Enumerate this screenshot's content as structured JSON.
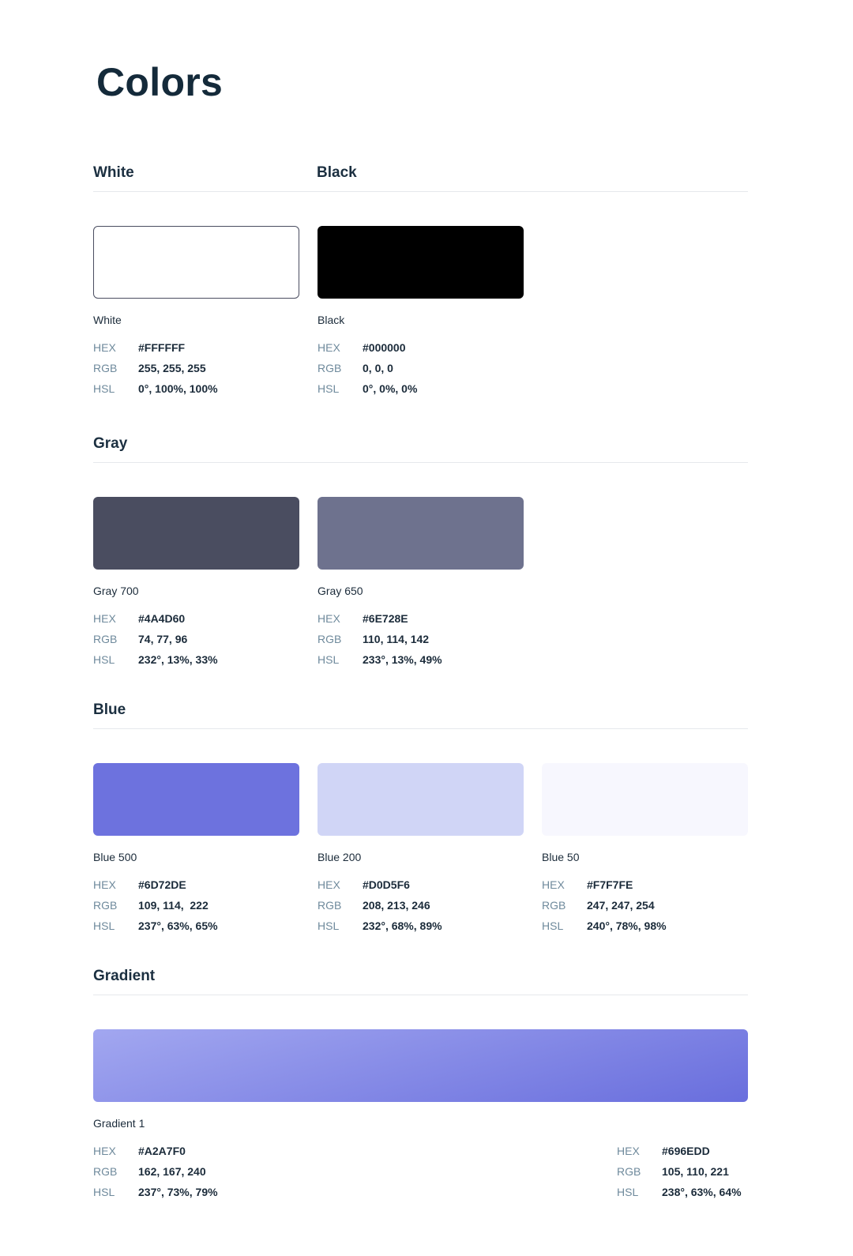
{
  "page": {
    "title": "Colors"
  },
  "sections": {
    "white": {
      "title": "White"
    },
    "black": {
      "title": "Black"
    },
    "gray": {
      "title": "Gray"
    },
    "blue": {
      "title": "Blue"
    },
    "gradient": {
      "title": "Gradient"
    }
  },
  "labels": {
    "hex": "HEX",
    "rgb": "RGB",
    "hsl": "HSL"
  },
  "swatches": {
    "white": {
      "name": "White",
      "hex": "#FFFFFF",
      "rgb": "255, 255, 255",
      "hsl": "0°, 100%, 100%",
      "color": "#FFFFFF"
    },
    "black": {
      "name": "Black",
      "hex": "#000000",
      "rgb": "0, 0, 0",
      "hsl": "0°, 0%, 0%",
      "color": "#000000"
    },
    "gray700": {
      "name": "Gray 700",
      "hex": "#4A4D60",
      "rgb": "74, 77, 96",
      "hsl": "232°, 13%, 33%",
      "color": "#4A4D60"
    },
    "gray650": {
      "name": "Gray 650",
      "hex": "#6E728E",
      "rgb": "110, 114, 142",
      "hsl": "233°, 13%, 49%",
      "color": "#6E728E"
    },
    "blue500": {
      "name": "Blue 500",
      "hex": "#6D72DE",
      "rgb": "109, 114,  222",
      "hsl": "237°, 63%, 65%",
      "color": "#6D72DE"
    },
    "blue200": {
      "name": "Blue 200",
      "hex": "#D0D5F6",
      "rgb": "208, 213, 246",
      "hsl": "232°, 68%, 89%",
      "color": "#D0D5F6"
    },
    "blue50": {
      "name": "Blue 50",
      "hex": "#F7F7FE",
      "rgb": "247, 247, 254",
      "hsl": "240°, 78%, 98%",
      "color": "#F7F7FE"
    }
  },
  "gradient": {
    "name": "Gradient 1",
    "start": {
      "hex": "#A2A7F0",
      "rgb": "162, 167, 240",
      "hsl": "237°, 73%, 79%",
      "color": "#A2A7F0"
    },
    "end": {
      "hex": "#696EDD",
      "rgb": "105, 110, 221",
      "hsl": "238°, 63%, 64%",
      "color": "#696EDD"
    }
  }
}
